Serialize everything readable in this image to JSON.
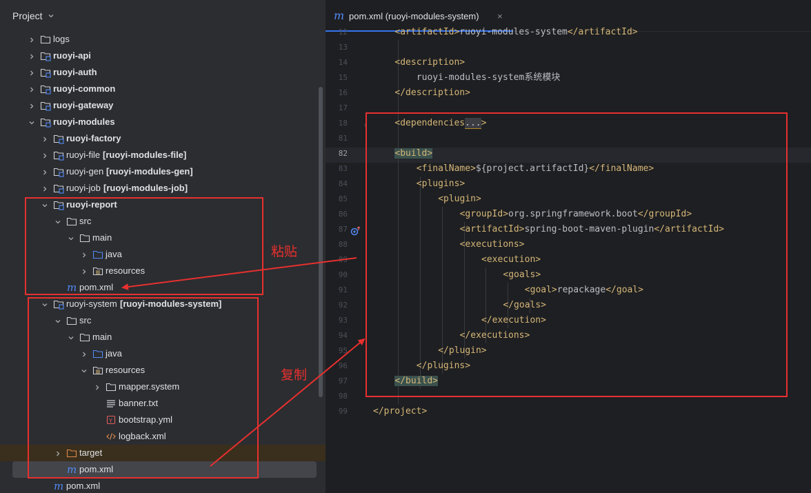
{
  "project_panel": {
    "title": "Project",
    "rows": [
      {
        "label": "logs",
        "suffix": ""
      },
      {
        "label": "ruoyi-api",
        "suffix": ""
      },
      {
        "label": "ruoyi-auth",
        "suffix": ""
      },
      {
        "label": "ruoyi-common",
        "suffix": ""
      },
      {
        "label": "ruoyi-gateway",
        "suffix": ""
      },
      {
        "label": "ruoyi-modules",
        "suffix": ""
      },
      {
        "label": "ruoyi-factory",
        "suffix": ""
      },
      {
        "label": "ruoyi-file",
        "suffix": "[ruoyi-modules-file]"
      },
      {
        "label": "ruoyi-gen",
        "suffix": "[ruoyi-modules-gen]"
      },
      {
        "label": "ruoyi-job",
        "suffix": "[ruoyi-modules-job]"
      },
      {
        "label": "ruoyi-report",
        "suffix": ""
      },
      {
        "label": "src",
        "suffix": ""
      },
      {
        "label": "main",
        "suffix": ""
      },
      {
        "label": "java",
        "suffix": ""
      },
      {
        "label": "resources",
        "suffix": ""
      },
      {
        "label": "pom.xml",
        "suffix": ""
      },
      {
        "label": "ruoyi-system",
        "suffix": "[ruoyi-modules-system]"
      },
      {
        "label": "src",
        "suffix": ""
      },
      {
        "label": "main",
        "suffix": ""
      },
      {
        "label": "java",
        "suffix": ""
      },
      {
        "label": "resources",
        "suffix": ""
      },
      {
        "label": "mapper.system",
        "suffix": ""
      },
      {
        "label": "banner.txt",
        "suffix": ""
      },
      {
        "label": "bootstrap.yml",
        "suffix": ""
      },
      {
        "label": "logback.xml",
        "suffix": ""
      },
      {
        "label": "target",
        "suffix": ""
      },
      {
        "label": "pom.xml",
        "suffix": ""
      },
      {
        "label": "pom.xml",
        "suffix": ""
      }
    ]
  },
  "editor": {
    "tab": {
      "icon": "m",
      "label": "pom.xml (ruoyi-modules-system)",
      "close": "×"
    },
    "line_numbers": [
      "12",
      "13",
      "14",
      "15",
      "16",
      "17",
      "18",
      "81",
      "82",
      "83",
      "84",
      "85",
      "86",
      "87",
      "88",
      "89",
      "90",
      "91",
      "92",
      "93",
      "94",
      "95",
      "96",
      "97",
      "98",
      "99"
    ],
    "lines": [
      {
        "parts": [
          {
            "t": "<artifactId>",
            "k": "tag"
          },
          {
            "t": "ruoyi-modules-system",
            "k": "txt"
          },
          {
            "t": "</artifactId>",
            "k": "tag"
          }
        ]
      },
      {
        "parts": []
      },
      {
        "parts": [
          {
            "t": "<description>",
            "k": "tag"
          }
        ]
      },
      {
        "parts": [
          {
            "t": "ruoyi-modules-system系统模块",
            "k": "txt"
          }
        ]
      },
      {
        "parts": [
          {
            "t": "</description>",
            "k": "tag"
          }
        ]
      },
      {
        "parts": []
      },
      {
        "parts": [
          {
            "t": "<dependencies",
            "k": "tag"
          },
          {
            "t": "...",
            "k": "dots"
          },
          {
            "t": ">",
            "k": "tag"
          }
        ]
      },
      {
        "parts": []
      },
      {
        "parts": [
          {
            "t": "<build>",
            "k": "tagmatch"
          }
        ]
      },
      {
        "parts": [
          {
            "t": "<finalName>",
            "k": "tag"
          },
          {
            "t": "${project.artifactId}",
            "k": "txt"
          },
          {
            "t": "</finalName>",
            "k": "tag"
          }
        ]
      },
      {
        "parts": [
          {
            "t": "<plugins>",
            "k": "tag"
          }
        ]
      },
      {
        "parts": [
          {
            "t": "<plugin>",
            "k": "tag"
          }
        ]
      },
      {
        "parts": [
          {
            "t": "<groupId>",
            "k": "tag"
          },
          {
            "t": "org.springframework.boot",
            "k": "txt"
          },
          {
            "t": "</groupId>",
            "k": "tag"
          }
        ]
      },
      {
        "parts": [
          {
            "t": "<artifactId>",
            "k": "tag"
          },
          {
            "t": "spring-boot-maven-plugin",
            "k": "txt"
          },
          {
            "t": "</artifactId>",
            "k": "tag"
          }
        ]
      },
      {
        "parts": [
          {
            "t": "<executions>",
            "k": "tag"
          }
        ]
      },
      {
        "parts": [
          {
            "t": "<execution>",
            "k": "tag"
          }
        ]
      },
      {
        "parts": [
          {
            "t": "<goals>",
            "k": "tag"
          }
        ]
      },
      {
        "parts": [
          {
            "t": "<goal>",
            "k": "tag"
          },
          {
            "t": "repackage",
            "k": "txt"
          },
          {
            "t": "</goal>",
            "k": "tag"
          }
        ]
      },
      {
        "parts": [
          {
            "t": "</goals>",
            "k": "tag"
          }
        ]
      },
      {
        "parts": [
          {
            "t": "</execution>",
            "k": "tag"
          }
        ]
      },
      {
        "parts": [
          {
            "t": "</executions>",
            "k": "tag"
          }
        ]
      },
      {
        "parts": [
          {
            "t": "</plugin>",
            "k": "tag"
          }
        ]
      },
      {
        "parts": [
          {
            "t": "</plugins>",
            "k": "tag"
          }
        ]
      },
      {
        "parts": [
          {
            "t": "</build>",
            "k": "tagmatch"
          }
        ]
      },
      {
        "parts": []
      },
      {
        "parts": [
          {
            "t": "</project>",
            "k": "tag"
          }
        ]
      }
    ]
  },
  "annotations": {
    "paste_label": "粘贴",
    "copy_label": "复制",
    "color": "#e8302f"
  },
  "colors": {
    "panel_bg": "#2b2d30",
    "editor_bg": "#1e1f22",
    "tag": "#d5b778",
    "text": "#bcbec4",
    "accent": "#3574f0",
    "folder_blue": "#548af7"
  }
}
